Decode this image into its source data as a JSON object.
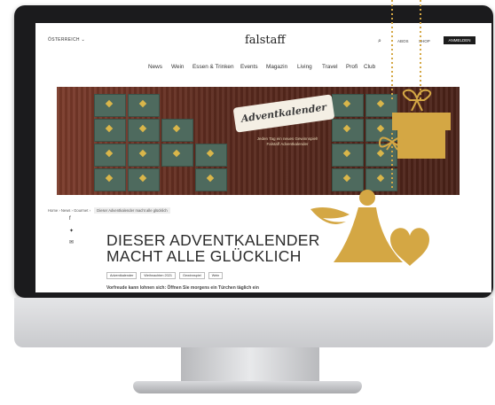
{
  "header": {
    "region": "ÖSTERREICH",
    "logo": "falstaff",
    "search_icon": "search-icon",
    "links": [
      "ABOS",
      "SHOP"
    ],
    "login_label": "ANMELDEN"
  },
  "nav": {
    "items": [
      "News",
      "Wein",
      "Essen & Trinken",
      "Events",
      "Magazin",
      "Living",
      "Travel",
      "Profi",
      "Club"
    ]
  },
  "hero": {
    "banner_text": "Adventkalender",
    "subline": [
      "Jeden Tag ein neues Gewinnspiel!",
      "Falstaff Adventkalender"
    ]
  },
  "breadcrumb": {
    "items": [
      "Home",
      "News",
      "Gourmet"
    ],
    "current": "Dieser Adventkalender macht alle glücklich"
  },
  "article": {
    "title_line1": "DIESER ADVENTKALENDER",
    "title_line2": "MACHT ALLE GLÜCKLICH",
    "tags": [
      "Adventkalender",
      "Weihnachten 2021",
      "Gewinnspiel",
      "Wein"
    ],
    "lead": "Vorfreude kann lohnen sich: Öffnen Sie morgens ein Türchen täglich ein"
  },
  "share_icons": [
    "facebook-icon",
    "twitter-icon",
    "mail-icon"
  ],
  "colors": {
    "gold": "#d4a744",
    "bezel": "#1b1b1d",
    "dark_button": "#1c1c1c"
  }
}
